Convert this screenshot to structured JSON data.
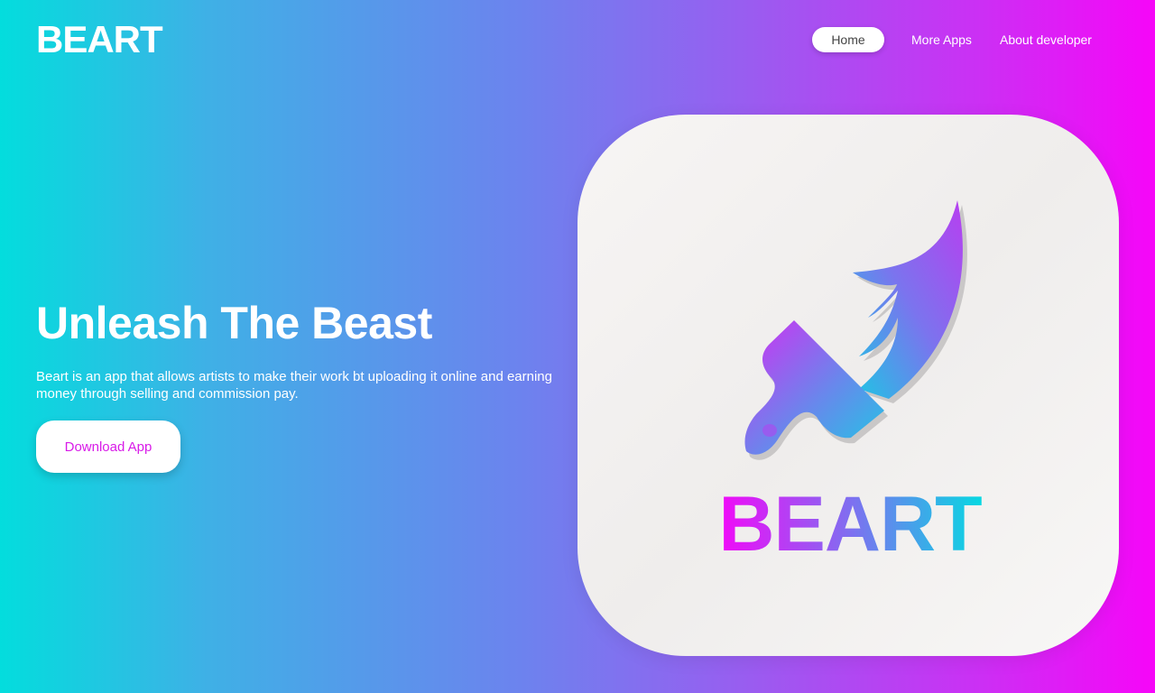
{
  "header": {
    "logo": "BEART",
    "nav": [
      {
        "label": "Home",
        "active": true
      },
      {
        "label": "More Apps",
        "active": false
      },
      {
        "label": "About developer",
        "active": false
      }
    ]
  },
  "hero": {
    "title": "Unleash The Beast",
    "description": "Beart is an app that allows artists to make their work bt uploading it online and earning money through selling and commission pay.",
    "cta_label": "Download App"
  },
  "app_icon": {
    "wordmark": "BEART",
    "icon": "paintbrush-icon"
  },
  "colors": {
    "gradient_start": "#03dddd",
    "gradient_end": "#f606f8",
    "accent": "#d81be8"
  }
}
